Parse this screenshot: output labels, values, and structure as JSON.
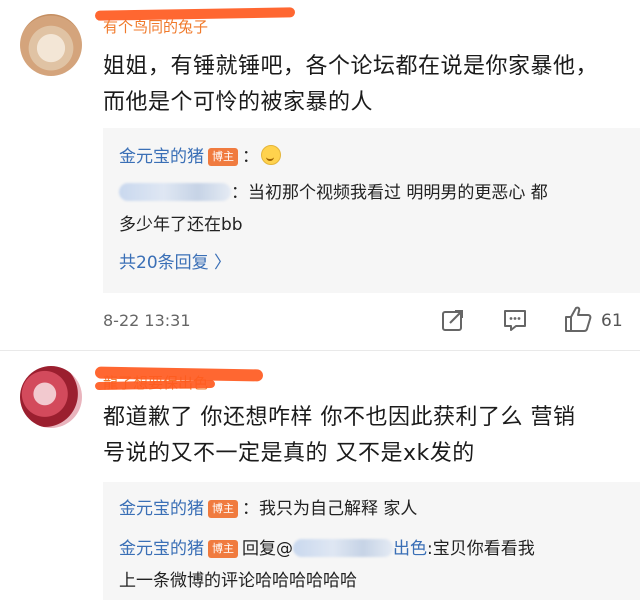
{
  "comments": [
    {
      "username": "有个鸟同的兔子",
      "body_lines": [
        "姐姐，有锤就锤吧，各个论坛都在说是你家暴他，",
        "而他是个可怜的被家暴的人"
      ],
      "replies": [
        {
          "name": "金元宝的猪",
          "badge": "博主",
          "sep": "：",
          "emoji": "crying-face"
        },
        {
          "line1": "：当初那个视频我看过 明明男的更恶心 都",
          "line2": "多少年了还在bb"
        }
      ],
      "more_link": "共20条回复 〉",
      "timestamp": "8-22 13:31",
      "like_count": "61"
    },
    {
      "username": "龍了想要保出色",
      "body_lines": [
        "都道歉了 你还想咋样 你不也因此获利了么 营销",
        "号说的又不一定是真的 又不是xk发的"
      ],
      "replies": [
        {
          "name": "金元宝的猪",
          "badge": "博主",
          "text": "：我只为自己解释 家人"
        },
        {
          "name": "金元宝的猪",
          "badge": "博主",
          "prefix": "回复@",
          "suffix": "出色",
          "text": ":宝贝你看看我",
          "line2": "上一条微博的评论哈哈哈哈哈哈"
        }
      ]
    }
  ]
}
